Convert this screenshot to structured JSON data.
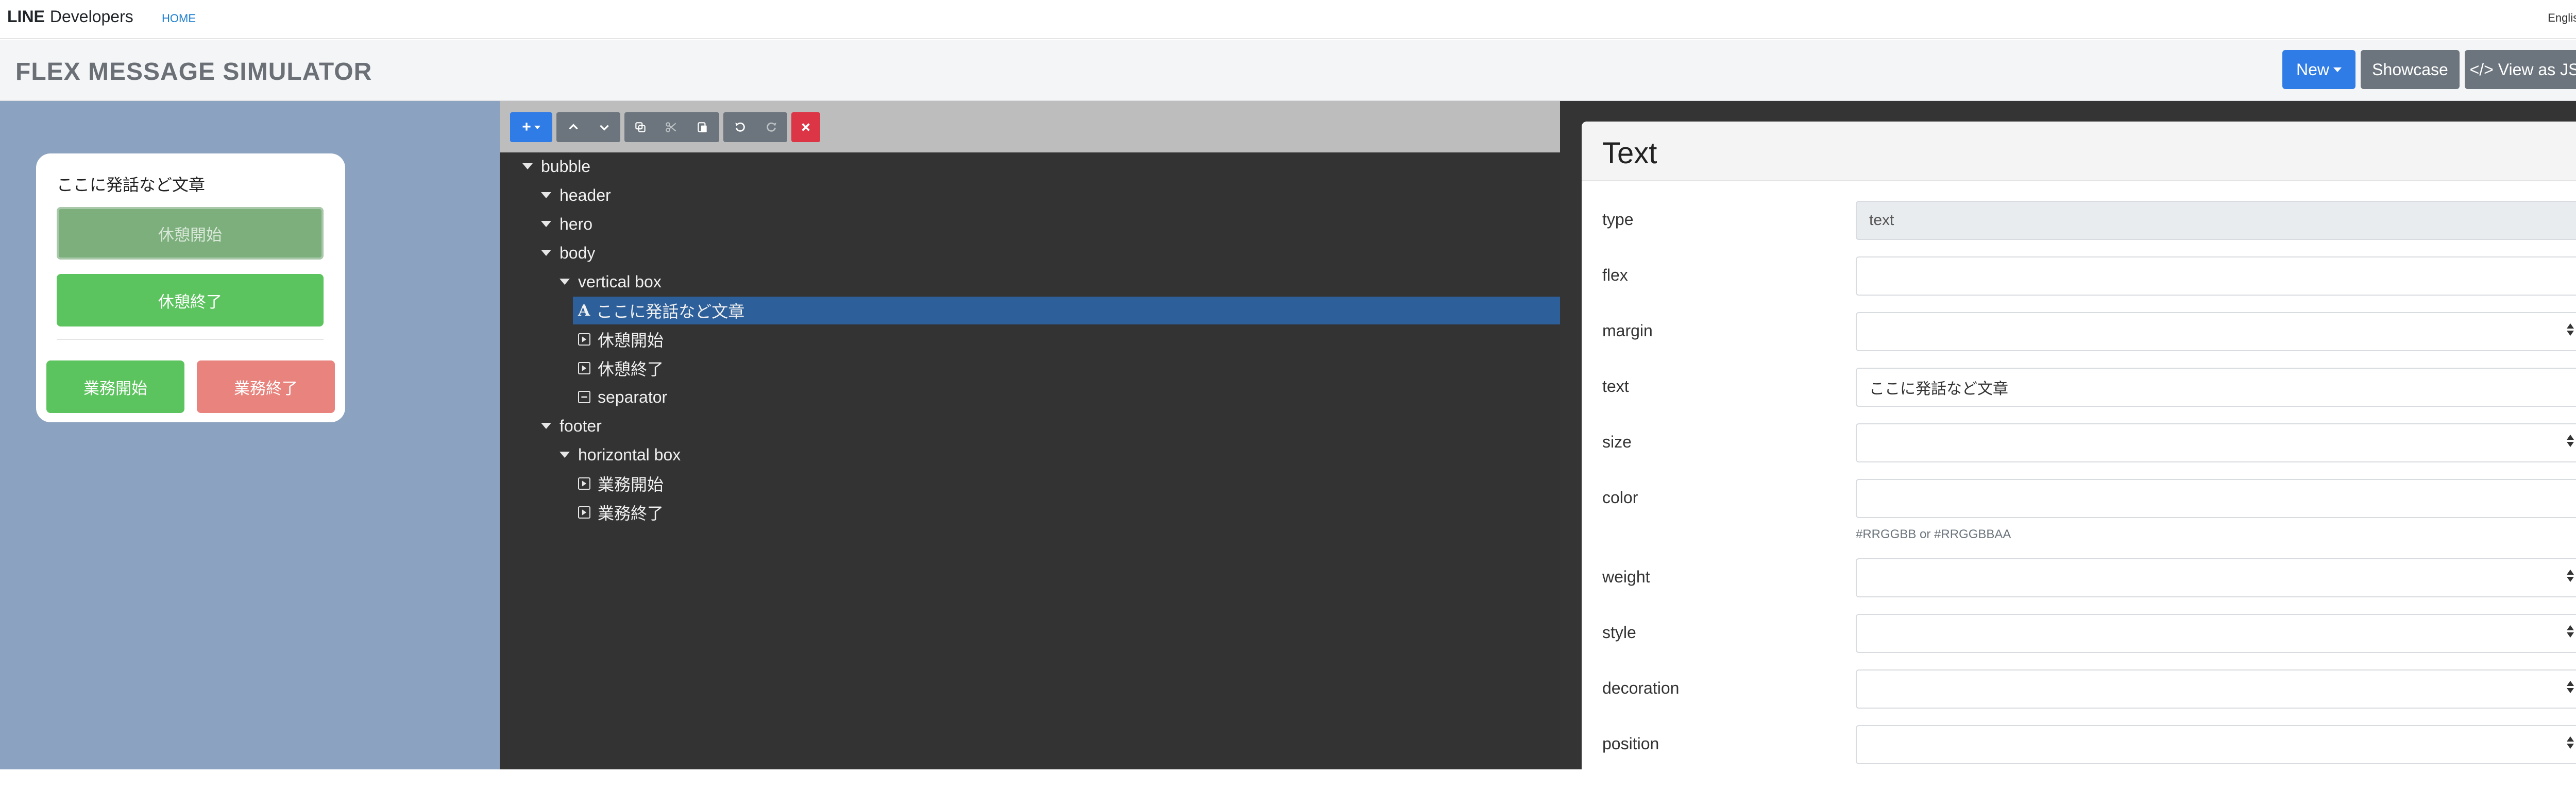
{
  "nav": {
    "brand_bold": "LINE",
    "brand_light": "Developers",
    "home": "HOME",
    "language": "English"
  },
  "titlebar": {
    "title": "FLEX MESSAGE SIMULATOR",
    "new_label": "New",
    "showcase_label": "Showcase",
    "json_label": "</> View as JSON"
  },
  "preview": {
    "text": "ここに発話など文章",
    "button_1": "休憩開始",
    "button_2": "休憩終了",
    "footer_button_1": "業務開始",
    "footer_button_2": "業務終了"
  },
  "tree": {
    "nodes": [
      {
        "label": "bubble",
        "kind": "expanded",
        "depth": 0
      },
      {
        "label": "header",
        "kind": "expanded",
        "depth": 1
      },
      {
        "label": "hero",
        "kind": "expanded",
        "depth": 1
      },
      {
        "label": "body",
        "kind": "expanded",
        "depth": 1
      },
      {
        "label": "vertical box",
        "kind": "expanded",
        "depth": 2
      },
      {
        "label": "ここに発話など文章",
        "kind": "text",
        "depth": 3,
        "selected": true
      },
      {
        "label": "休憩開始",
        "kind": "button",
        "depth": 3
      },
      {
        "label": "休憩終了",
        "kind": "button",
        "depth": 3
      },
      {
        "label": "separator",
        "kind": "separator",
        "depth": 3
      },
      {
        "label": "footer",
        "kind": "expanded",
        "depth": 1
      },
      {
        "label": "horizontal box",
        "kind": "expanded",
        "depth": 2
      },
      {
        "label": "業務開始",
        "kind": "button",
        "depth": 3
      },
      {
        "label": "業務終了",
        "kind": "button",
        "depth": 3
      }
    ]
  },
  "props": {
    "title": "Text",
    "type_label": "type",
    "type_value": "text",
    "flex_label": "flex",
    "margin_label": "margin",
    "text_label": "text",
    "text_value": "ここに発話など文章",
    "size_label": "size",
    "color_label": "color",
    "color_hint": "#RRGGBB or #RRGGBBAA",
    "weight_label": "weight",
    "style_label": "style",
    "decoration_label": "decoration",
    "position_label": "position"
  },
  "colors": {
    "accent": "#2f7ce6",
    "preview_bg": "#8ba2c0",
    "green": "#5cc45e",
    "red_button": "#e8837d",
    "tree_selected": "#2d5f9a"
  }
}
